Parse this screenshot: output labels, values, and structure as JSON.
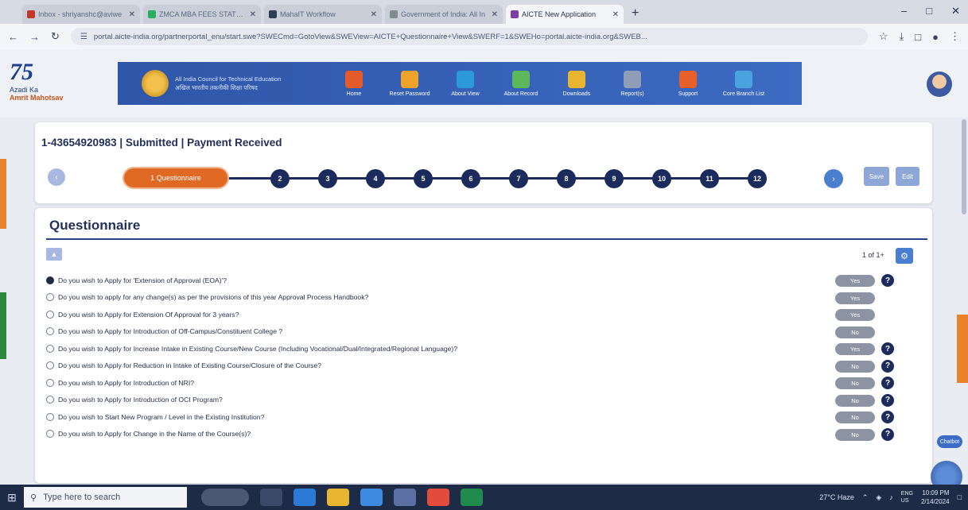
{
  "browser": {
    "tabs": [
      {
        "label": "Inbox - shriyanshc@aviwe",
        "color": "#c0392b"
      },
      {
        "label": "ZMCA MBA FEES STATEMENT",
        "color": "#27ae60"
      },
      {
        "label": "MahaIT Workflow",
        "color": "#2c3e50"
      },
      {
        "label": "Government of India: All In",
        "color": "#7f8c8d"
      },
      {
        "label": "AICTE New Application",
        "color": "#7b3fa0",
        "active": true
      }
    ],
    "url": "portal.aicte-india.org/partnerportal_enu/start.swe?SWECmd=GotoView&SWEView=AICTE+Questionnaire+View&SWERF=1&SWEHo=portal.aicte-india.org&SWEB..."
  },
  "header": {
    "logo": {
      "line1": "75",
      "line2": "Azadi Ka",
      "line3": "Amrit Mahotsav"
    },
    "org_name": "All India Council for Technical Education अखिल भारतीय तकनीकी शिक्षा परिषद",
    "nav": [
      {
        "label": "Home",
        "color": "#e45b2a"
      },
      {
        "label": "Reset Password",
        "color": "#f0a32b"
      },
      {
        "label": "About View",
        "color": "#2a9bd8"
      },
      {
        "label": "About Record",
        "color": "#5db85c"
      },
      {
        "label": "Downloads",
        "color": "#e8b530"
      },
      {
        "label": "Report(s)",
        "color": "#8f9db8"
      },
      {
        "label": "Support",
        "color": "#e85f2a"
      },
      {
        "label": "Core Branch List",
        "color": "#4aa3df"
      }
    ]
  },
  "record": {
    "title": "1-43654920983 | Submitted | Payment Received",
    "active_step": "1  Questionnaire",
    "steps": [
      "2",
      "3",
      "4",
      "5",
      "6",
      "7",
      "8",
      "9",
      "10",
      "11",
      "12"
    ],
    "buttons": {
      "save": "Save",
      "edit": "Edit"
    }
  },
  "questionnaire": {
    "title": "Questionnaire",
    "pager": "1 of 1+",
    "rows": [
      {
        "q": "Do you wish to Apply for 'Extension of Approval (EOA)'?",
        "toggle": "Yes",
        "help": true,
        "selected": true
      },
      {
        "q": "Do you wish to apply for any change(s) as per the provisions of this year Approval Process Handbook?",
        "toggle": "Yes",
        "help": false
      },
      {
        "q": "Do you wish to Apply for Extension Of Approval for 3 years?",
        "toggle": "Yes",
        "help": false
      },
      {
        "q": "Do you wish to Apply for Introduction of Off-Campus/Constituent College ?",
        "toggle": "No",
        "help": false
      },
      {
        "q": "Do you wish to Apply for Increase Intake in Existing Course/New Course (Including Vocational/Dual/Integrated/Regional Language)?",
        "toggle": "Yes",
        "help": true
      },
      {
        "q": "Do you wish to Apply for Reduction in Intake of Existing Course/Closure of the Course?",
        "toggle": "No",
        "help": true
      },
      {
        "q": "Do you wish to Apply for Introduction of NRI?",
        "toggle": "No",
        "help": true
      },
      {
        "q": "Do you wish to Apply for Introduction of OCI Program?",
        "toggle": "No",
        "help": true
      },
      {
        "q": "Do you wish to Start New Program / Level in the Existing Institution?",
        "toggle": "No",
        "help": true
      },
      {
        "q": "Do you wish to Apply for Change in the Name of the Course(s)?",
        "toggle": "No",
        "help": true
      }
    ]
  },
  "taskbar": {
    "search_placeholder": "Type here to search",
    "weather": "27°C  Haze",
    "time": "10:09 PM",
    "date": "2/14/2024",
    "lang": "ENG\nUS",
    "chat_label": "Chatbot"
  }
}
